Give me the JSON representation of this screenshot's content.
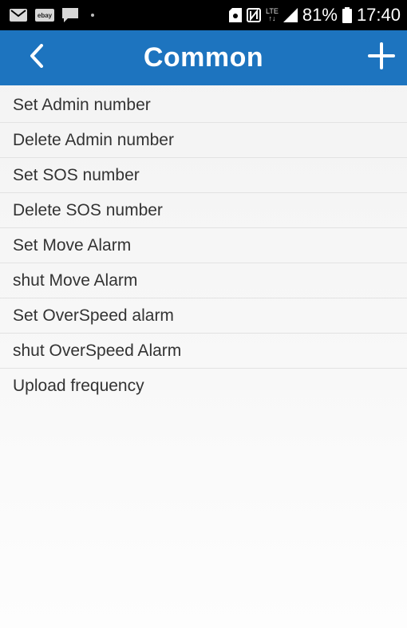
{
  "status_bar": {
    "left_icons": [
      "mail-icon",
      "ebay-icon",
      "message-icon",
      "notification-dot"
    ],
    "ebay_label": "ebay",
    "right_icons": [
      "sim-icon",
      "nfc-icon",
      "lte-icon",
      "signal-icon",
      "battery-icon"
    ],
    "lte_label": "LTE",
    "battery": "81%",
    "time": "17:40"
  },
  "header": {
    "title": "Common",
    "back_icon": "chevron-left-icon",
    "add_icon": "plus-icon",
    "background": "#1d74bf"
  },
  "commands": [
    {
      "label": "Set Admin number"
    },
    {
      "label": "Delete Admin number"
    },
    {
      "label": "Set SOS number"
    },
    {
      "label": "Delete SOS number"
    },
    {
      "label": "Set Move Alarm"
    },
    {
      "label": "shut Move Alarm"
    },
    {
      "label": "Set OverSpeed alarm"
    },
    {
      "label": "shut OverSpeed Alarm"
    },
    {
      "label": "Upload frequency"
    }
  ]
}
